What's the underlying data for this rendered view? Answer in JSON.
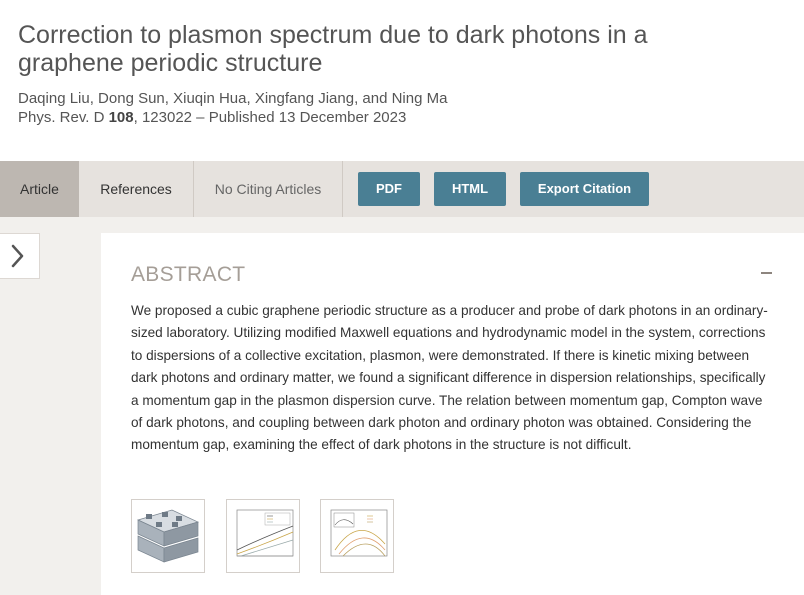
{
  "article": {
    "title": "Correction to plasmon spectrum due to dark photons in a graphene periodic structure",
    "authors": "Daqing Liu, Dong Sun, Xiuqin Hua, Xingfang Jiang, and Ning Ma",
    "journal": "Phys. Rev. D",
    "volume": "108",
    "rest": ", 123022 – Published 13 December 2023"
  },
  "tabs": {
    "article": "Article",
    "references": "References",
    "citing": "No Citing Articles"
  },
  "buttons": {
    "pdf": "PDF",
    "html": "HTML",
    "export": "Export Citation"
  },
  "abstract": {
    "heading": "ABSTRACT",
    "text": "We proposed a cubic graphene periodic structure as a producer and probe of dark photons in an ordinary-sized laboratory. Utilizing modified Maxwell equations and hydrodynamic model in the system, corrections to dispersions of a collective excitation, plasmon, were demonstrated. If there is kinetic mixing between dark photons and ordinary matter, we found a significant difference in dispersion relationships, specifically a momentum gap in the plasmon dispersion curve. The relation between momentum gap, Compton wave of dark photons, and coupling between dark photon and ordinary photon was obtained. Considering the momentum gap, examining the effect of dark photons in the structure is not difficult."
  },
  "icons": {
    "sidebar_toggle": "chevron-right-icon",
    "collapse": "minus-icon"
  },
  "colors": {
    "button": "#4a7f94",
    "tabbar": "#e6e2de",
    "active_tab": "#bdb7b1",
    "heading": "#a59e97"
  }
}
